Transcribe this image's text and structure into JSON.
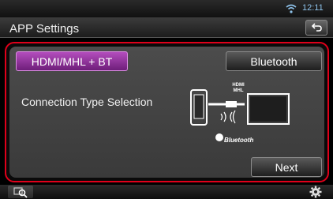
{
  "status": {
    "time": "12:11",
    "wifi_icon": "wifi-icon"
  },
  "header": {
    "title": "APP Settings",
    "back_icon": "back-arrow-icon"
  },
  "main": {
    "hdmi_button_label": "HDMI/MHL + BT",
    "bluetooth_button_label": "Bluetooth",
    "connection_label": "Connection Type Selection",
    "illustration": {
      "hdmi_logo_text": "HDMI MHL",
      "bluetooth_logo_text": "Bluetooth"
    },
    "next_label": "Next"
  },
  "footer": {
    "left_icon": "search-icon",
    "right_icon": "gear-icon"
  },
  "colors": {
    "selected_accent": "#b34dbd",
    "frame": "#e0001a",
    "clock": "#8ec2ea"
  }
}
